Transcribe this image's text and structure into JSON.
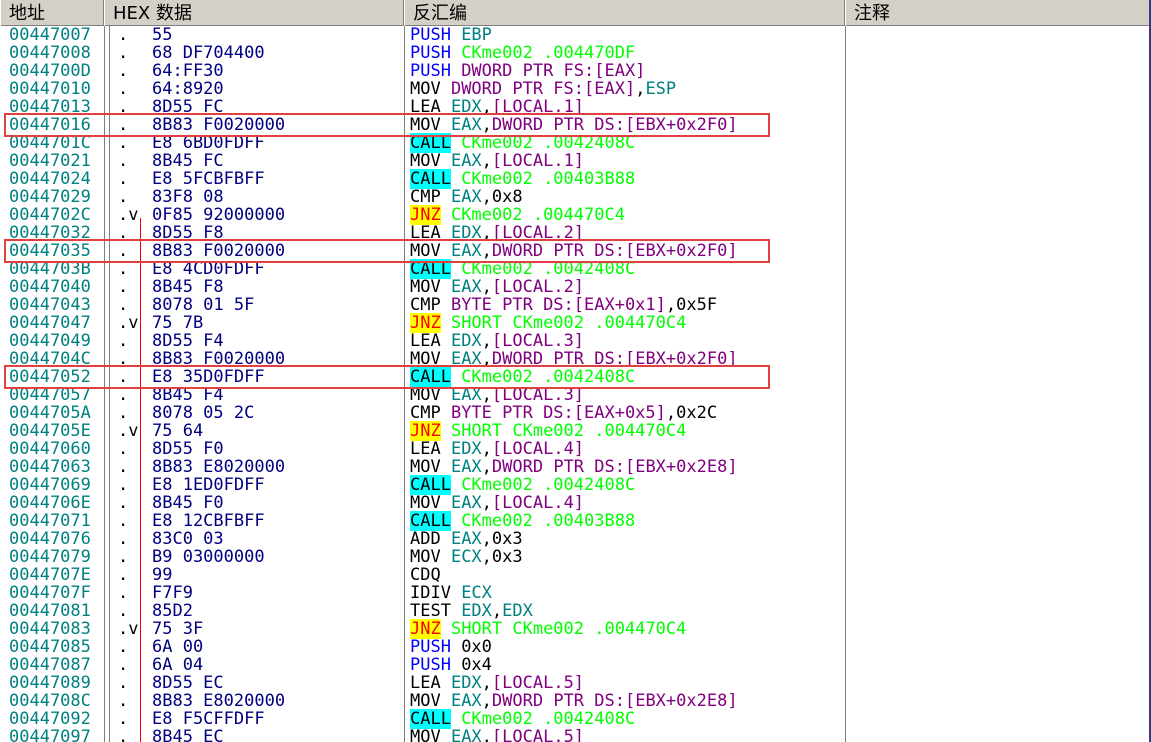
{
  "columns": {
    "address": "地址",
    "hex": "HEX 数据",
    "disasm": "反汇编",
    "comment": "注释"
  },
  "highlight_rows": [
    5,
    12,
    19
  ],
  "rows": [
    {
      "addr": "00447007",
      "mark": ".",
      "hex": "55",
      "dis": [
        [
          "PUSH ",
          "blue"
        ],
        [
          "EBP",
          "teal"
        ]
      ]
    },
    {
      "addr": "00447008",
      "mark": ".",
      "hex": "68 DF704400",
      "dis": [
        [
          "PUSH ",
          "blue"
        ],
        [
          "CKme002 .004470DF",
          "green"
        ]
      ]
    },
    {
      "addr": "0044700D",
      "mark": ".",
      "hex": "64:FF30",
      "dis": [
        [
          "PUSH ",
          "blue"
        ],
        [
          "DWORD PTR FS:[EAX]",
          "purp"
        ]
      ]
    },
    {
      "addr": "00447010",
      "mark": ".",
      "hex": "64:8920",
      "dis": [
        [
          "MOV ",
          "blk"
        ],
        [
          "DWORD PTR FS:[EAX]",
          "purp"
        ],
        [
          ",",
          "blk"
        ],
        [
          "ESP",
          "teal"
        ]
      ]
    },
    {
      "addr": "00447013",
      "mark": ".",
      "hex": "8D55 FC",
      "dis": [
        [
          "LEA ",
          "blk"
        ],
        [
          "EDX",
          "teal"
        ],
        [
          ",",
          "blk"
        ],
        [
          "[LOCAL.1]",
          "purp"
        ]
      ]
    },
    {
      "addr": "00447016",
      "mark": ".",
      "hex": "8B83 F0020000",
      "dis": [
        [
          "MOV ",
          "blk"
        ],
        [
          "EAX",
          "teal"
        ],
        [
          ",",
          "blk"
        ],
        [
          "DWORD PTR DS:[EBX+0x2F0]",
          "purp"
        ]
      ]
    },
    {
      "addr": "0044701C",
      "mark": ".",
      "hex": "E8 6BD0FDFF",
      "dis": [
        [
          "CALL",
          "call"
        ],
        [
          " CKme002 .0042408C",
          "green"
        ]
      ]
    },
    {
      "addr": "00447021",
      "mark": ".",
      "hex": "8B45 FC",
      "dis": [
        [
          "MOV ",
          "blk"
        ],
        [
          "EAX",
          "teal"
        ],
        [
          ",",
          "blk"
        ],
        [
          "[LOCAL.1]",
          "purp"
        ]
      ]
    },
    {
      "addr": "00447024",
      "mark": ".",
      "hex": "E8 5FCBFBFF",
      "dis": [
        [
          "CALL",
          "call"
        ],
        [
          " CKme002 .00403B88",
          "green"
        ]
      ]
    },
    {
      "addr": "00447029",
      "mark": ".",
      "hex": "83F8 08",
      "dis": [
        [
          "CMP ",
          "blk"
        ],
        [
          "EAX",
          "teal"
        ],
        [
          ",0x8",
          "blk"
        ]
      ]
    },
    {
      "addr": "0044702C",
      "mark": ".v",
      "hex": "0F85 92000000",
      "dis": [
        [
          "JNZ",
          "jnz"
        ],
        [
          " CKme002 .004470C4",
          "green"
        ]
      ]
    },
    {
      "addr": "00447032",
      "mark": ".",
      "hex": "8D55 F8",
      "dis": [
        [
          "LEA ",
          "blk"
        ],
        [
          "EDX",
          "teal"
        ],
        [
          ",",
          "blk"
        ],
        [
          "[LOCAL.2]",
          "purp"
        ]
      ]
    },
    {
      "addr": "00447035",
      "mark": ".",
      "hex": "8B83 F0020000",
      "dis": [
        [
          "MOV ",
          "blk"
        ],
        [
          "EAX",
          "teal"
        ],
        [
          ",",
          "blk"
        ],
        [
          "DWORD PTR DS:[EBX+0x2F0]",
          "purp"
        ]
      ]
    },
    {
      "addr": "0044703B",
      "mark": ".",
      "hex": "E8 4CD0FDFF",
      "dis": [
        [
          "CALL",
          "call"
        ],
        [
          " CKme002 .0042408C",
          "green"
        ]
      ]
    },
    {
      "addr": "00447040",
      "mark": ".",
      "hex": "8B45 F8",
      "dis": [
        [
          "MOV ",
          "blk"
        ],
        [
          "EAX",
          "teal"
        ],
        [
          ",",
          "blk"
        ],
        [
          "[LOCAL.2]",
          "purp"
        ]
      ]
    },
    {
      "addr": "00447043",
      "mark": ".",
      "hex": "8078 01 5F",
      "dis": [
        [
          "CMP ",
          "blk"
        ],
        [
          "BYTE PTR DS:[EAX+0x1]",
          "purp"
        ],
        [
          ",0x5F",
          "blk"
        ]
      ]
    },
    {
      "addr": "00447047",
      "mark": ".v",
      "hex": "75 7B",
      "dis": [
        [
          "JNZ",
          "jnz"
        ],
        [
          " SHORT CKme002 .004470C4",
          "green"
        ]
      ]
    },
    {
      "addr": "00447049",
      "mark": ".",
      "hex": "8D55 F4",
      "dis": [
        [
          "LEA ",
          "blk"
        ],
        [
          "EDX",
          "teal"
        ],
        [
          ",",
          "blk"
        ],
        [
          "[LOCAL.3]",
          "purp"
        ]
      ]
    },
    {
      "addr": "0044704C",
      "mark": ".",
      "hex": "8B83 F0020000",
      "dis": [
        [
          "MOV ",
          "blk"
        ],
        [
          "EAX",
          "teal"
        ],
        [
          ",",
          "blk"
        ],
        [
          "DWORD PTR DS:[EBX+0x2F0]",
          "purp"
        ]
      ]
    },
    {
      "addr": "00447052",
      "mark": ".",
      "hex": "E8 35D0FDFF",
      "dis": [
        [
          "CALL",
          "call"
        ],
        [
          " CKme002 .0042408C",
          "green"
        ]
      ]
    },
    {
      "addr": "00447057",
      "mark": ".",
      "hex": "8B45 F4",
      "dis": [
        [
          "MOV ",
          "blk"
        ],
        [
          "EAX",
          "teal"
        ],
        [
          ",",
          "blk"
        ],
        [
          "[LOCAL.3]",
          "purp"
        ]
      ]
    },
    {
      "addr": "0044705A",
      "mark": ".",
      "hex": "8078 05 2C",
      "dis": [
        [
          "CMP ",
          "blk"
        ],
        [
          "BYTE PTR DS:[EAX+0x5]",
          "purp"
        ],
        [
          ",0x2C",
          "blk"
        ]
      ]
    },
    {
      "addr": "0044705E",
      "mark": ".v",
      "hex": "75 64",
      "dis": [
        [
          "JNZ",
          "jnz"
        ],
        [
          " SHORT CKme002 .004470C4",
          "green"
        ]
      ]
    },
    {
      "addr": "00447060",
      "mark": ".",
      "hex": "8D55 F0",
      "dis": [
        [
          "LEA ",
          "blk"
        ],
        [
          "EDX",
          "teal"
        ],
        [
          ",",
          "blk"
        ],
        [
          "[LOCAL.4]",
          "purp"
        ]
      ]
    },
    {
      "addr": "00447063",
      "mark": ".",
      "hex": "8B83 E8020000",
      "dis": [
        [
          "MOV ",
          "blk"
        ],
        [
          "EAX",
          "teal"
        ],
        [
          ",",
          "blk"
        ],
        [
          "DWORD PTR DS:[EBX+0x2E8]",
          "purp"
        ]
      ]
    },
    {
      "addr": "00447069",
      "mark": ".",
      "hex": "E8 1ED0FDFF",
      "dis": [
        [
          "CALL",
          "call"
        ],
        [
          " CKme002 .0042408C",
          "green"
        ]
      ]
    },
    {
      "addr": "0044706E",
      "mark": ".",
      "hex": "8B45 F0",
      "dis": [
        [
          "MOV ",
          "blk"
        ],
        [
          "EAX",
          "teal"
        ],
        [
          ",",
          "blk"
        ],
        [
          "[LOCAL.4]",
          "purp"
        ]
      ]
    },
    {
      "addr": "00447071",
      "mark": ".",
      "hex": "E8 12CBFBFF",
      "dis": [
        [
          "CALL",
          "call"
        ],
        [
          " CKme002 .00403B88",
          "green"
        ]
      ]
    },
    {
      "addr": "00447076",
      "mark": ".",
      "hex": "83C0 03",
      "dis": [
        [
          "ADD ",
          "blk"
        ],
        [
          "EAX",
          "teal"
        ],
        [
          ",0x3",
          "blk"
        ]
      ]
    },
    {
      "addr": "00447079",
      "mark": ".",
      "hex": "B9 03000000",
      "dis": [
        [
          "MOV ",
          "blk"
        ],
        [
          "ECX",
          "teal"
        ],
        [
          ",0x3",
          "blk"
        ]
      ]
    },
    {
      "addr": "0044707E",
      "mark": ".",
      "hex": "99",
      "dis": [
        [
          "CDQ",
          "blk"
        ]
      ]
    },
    {
      "addr": "0044707F",
      "mark": ".",
      "hex": "F7F9",
      "dis": [
        [
          "IDIV ",
          "blk"
        ],
        [
          "ECX",
          "teal"
        ]
      ]
    },
    {
      "addr": "00447081",
      "mark": ".",
      "hex": "85D2",
      "dis": [
        [
          "TEST ",
          "blk"
        ],
        [
          "EDX",
          "teal"
        ],
        [
          ",",
          "blk"
        ],
        [
          "EDX",
          "teal"
        ]
      ]
    },
    {
      "addr": "00447083",
      "mark": ".v",
      "hex": "75 3F",
      "dis": [
        [
          "JNZ",
          "jnz"
        ],
        [
          " SHORT CKme002 .004470C4",
          "green"
        ]
      ]
    },
    {
      "addr": "00447085",
      "mark": ".",
      "hex": "6A 00",
      "dis": [
        [
          "PUSH ",
          "blue"
        ],
        [
          "0x0",
          "blk"
        ]
      ]
    },
    {
      "addr": "00447087",
      "mark": ".",
      "hex": "6A 04",
      "dis": [
        [
          "PUSH ",
          "blue"
        ],
        [
          "0x4",
          "blk"
        ]
      ]
    },
    {
      "addr": "00447089",
      "mark": ".",
      "hex": "8D55 EC",
      "dis": [
        [
          "LEA ",
          "blk"
        ],
        [
          "EDX",
          "teal"
        ],
        [
          ",",
          "blk"
        ],
        [
          "[LOCAL.5]",
          "purp"
        ]
      ]
    },
    {
      "addr": "0044708C",
      "mark": ".",
      "hex": "8B83 E8020000",
      "dis": [
        [
          "MOV ",
          "blk"
        ],
        [
          "EAX",
          "teal"
        ],
        [
          ",",
          "blk"
        ],
        [
          "DWORD PTR DS:[EBX+0x2E8]",
          "purp"
        ]
      ]
    },
    {
      "addr": "00447092",
      "mark": ".",
      "hex": "E8 F5CFFDFF",
      "dis": [
        [
          "CALL",
          "call"
        ],
        [
          " CKme002 .0042408C",
          "green"
        ]
      ]
    },
    {
      "addr": "00447097",
      "mark": ".",
      "hex": "8B45 EC",
      "dis": [
        [
          "MOV ",
          "blk"
        ],
        [
          "EAX",
          "teal"
        ],
        [
          ",",
          "blk"
        ],
        [
          "[LOCAL.5]",
          "purp"
        ]
      ]
    }
  ]
}
